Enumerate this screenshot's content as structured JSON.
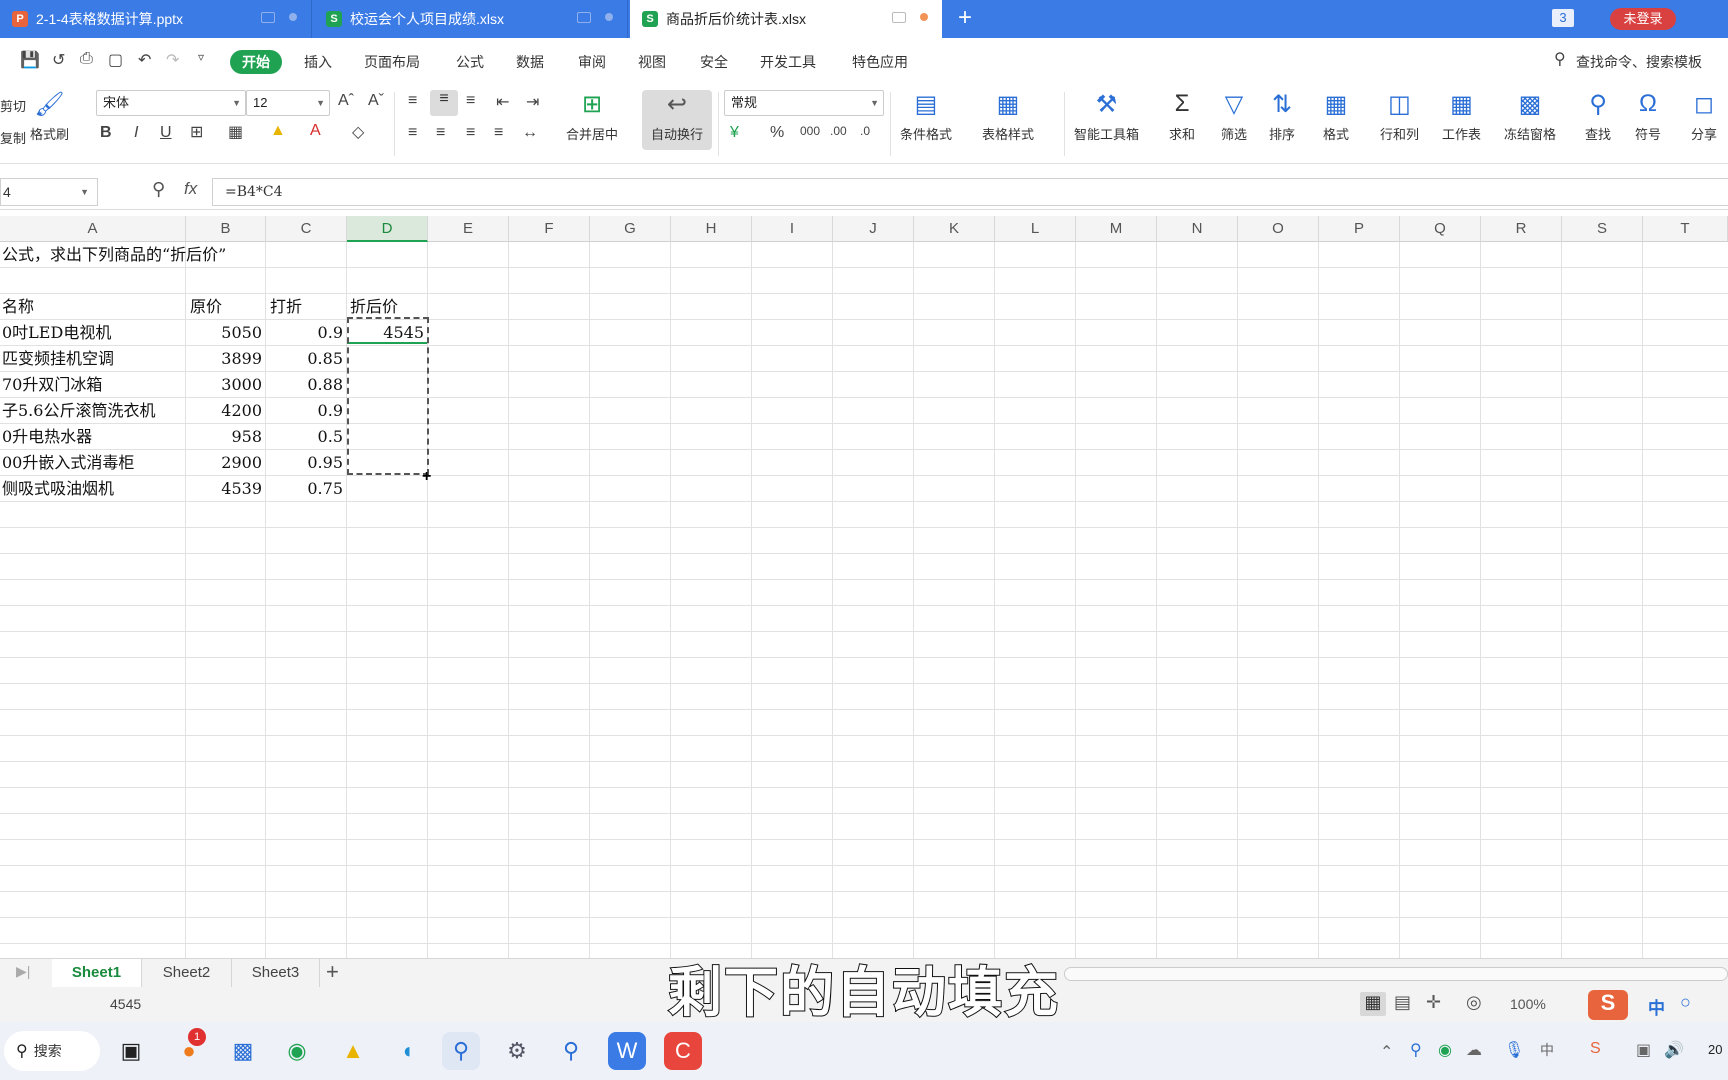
{
  "tabs": [
    {
      "name": "2-1-4表格数据计算.pptx",
      "type": "P",
      "color": "#e8643c"
    },
    {
      "name": "校运会个人项目成绩.xlsx",
      "type": "S",
      "color": "#1fa251"
    },
    {
      "name": "商品折后价统计表.xlsx",
      "type": "S",
      "color": "#1fa251"
    }
  ],
  "tabbar": {
    "new_tab": "+",
    "window_count": "3",
    "login": "未登录"
  },
  "menu": [
    "开始",
    "插入",
    "页面布局",
    "公式",
    "数据",
    "审阅",
    "视图",
    "安全",
    "开发工具",
    "特色应用"
  ],
  "search_command": "查找命令、搜索模板",
  "ribbon": {
    "cut": "剪切",
    "copy": "复制",
    "format_painter": "格式刷",
    "font_name": "宋体",
    "font_size": "12",
    "merge": "合并居中",
    "wrap": "自动换行",
    "number_format": "常规",
    "cond_format": "条件格式",
    "table_style": "表格样式",
    "smart_tools": "智能工具箱",
    "sum": "求和",
    "filter": "筛选",
    "sort": "排序",
    "format": "格式",
    "rowcol": "行和列",
    "sheet": "工作表",
    "freeze": "冻结窗格",
    "find": "查找",
    "symbol": "符号",
    "share": "分享"
  },
  "namebox": "4",
  "formula": "=B4*C4",
  "columns": [
    "A",
    "B",
    "C",
    "D",
    "E",
    "F",
    "G",
    "H",
    "I",
    "J",
    "K",
    "L",
    "M",
    "N",
    "O",
    "P",
    "Q",
    "R",
    "S",
    "T"
  ],
  "rows": {
    "title": "公式，求出下列商品的“折后价”",
    "headers": [
      "名称",
      "原价",
      "打折",
      "折后价"
    ],
    "items": [
      {
        "name": "0吋LED电视机",
        "price": "5050",
        "discount": "0.9",
        "final": "4545"
      },
      {
        "name": "匹变频挂机空调",
        "price": "3899",
        "discount": "0.85",
        "final": ""
      },
      {
        "name": "70升双门冰箱",
        "price": "3000",
        "discount": "0.88",
        "final": ""
      },
      {
        "name": "子5.6公斤滚筒洗衣机",
        "price": "4200",
        "discount": "0.9",
        "final": ""
      },
      {
        "name": "0升电热水器",
        "price": "958",
        "discount": "0.5",
        "final": ""
      },
      {
        "name": "00升嵌入式消毒柜",
        "price": "2900",
        "discount": "0.95",
        "final": ""
      },
      {
        "name": "侧吸式吸油烟机",
        "price": "4539",
        "discount": "0.75",
        "final": ""
      }
    ]
  },
  "sheets": [
    "Sheet1",
    "Sheet2",
    "Sheet3"
  ],
  "status": {
    "cell_value": "4545",
    "zoom": "100%",
    "ime": "中"
  },
  "subtitle": "剩下的自动填充",
  "taskbar": {
    "search": "搜索",
    "badge": "1",
    "clock": "20"
  }
}
